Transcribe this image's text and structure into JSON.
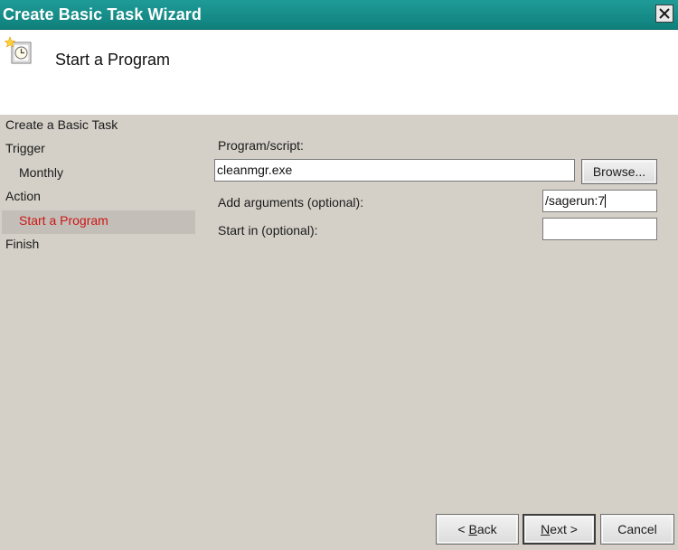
{
  "window": {
    "title": "Create Basic Task Wizard"
  },
  "header": {
    "title": "Start a Program",
    "icon": "clock-star-icon"
  },
  "nav": {
    "items": [
      {
        "label": "Create a Basic Task"
      },
      {
        "label": "Trigger"
      },
      {
        "label": "Monthly"
      },
      {
        "label": "Action"
      },
      {
        "label": "Start a Program"
      },
      {
        "label": "Finish"
      }
    ],
    "active_color": "#cc1616"
  },
  "form": {
    "program_label": "Program/script:",
    "program_value": "cleanmgr.exe",
    "browse_pre": "Browse",
    "browse_post": "...",
    "args_label": "Add arguments (optional):",
    "args_value": "/sagerun:7",
    "startin_label": "Start in (optional):",
    "startin_value": ""
  },
  "buttons": {
    "back_pre": "< ",
    "back_key": "B",
    "back_post": "ack",
    "next_key": "N",
    "next_post": "ext >",
    "cancel": "Cancel"
  },
  "colors": {
    "titlebar": "#14918d",
    "panel": "#d4d0c8",
    "active_nav": "#cc1616"
  }
}
